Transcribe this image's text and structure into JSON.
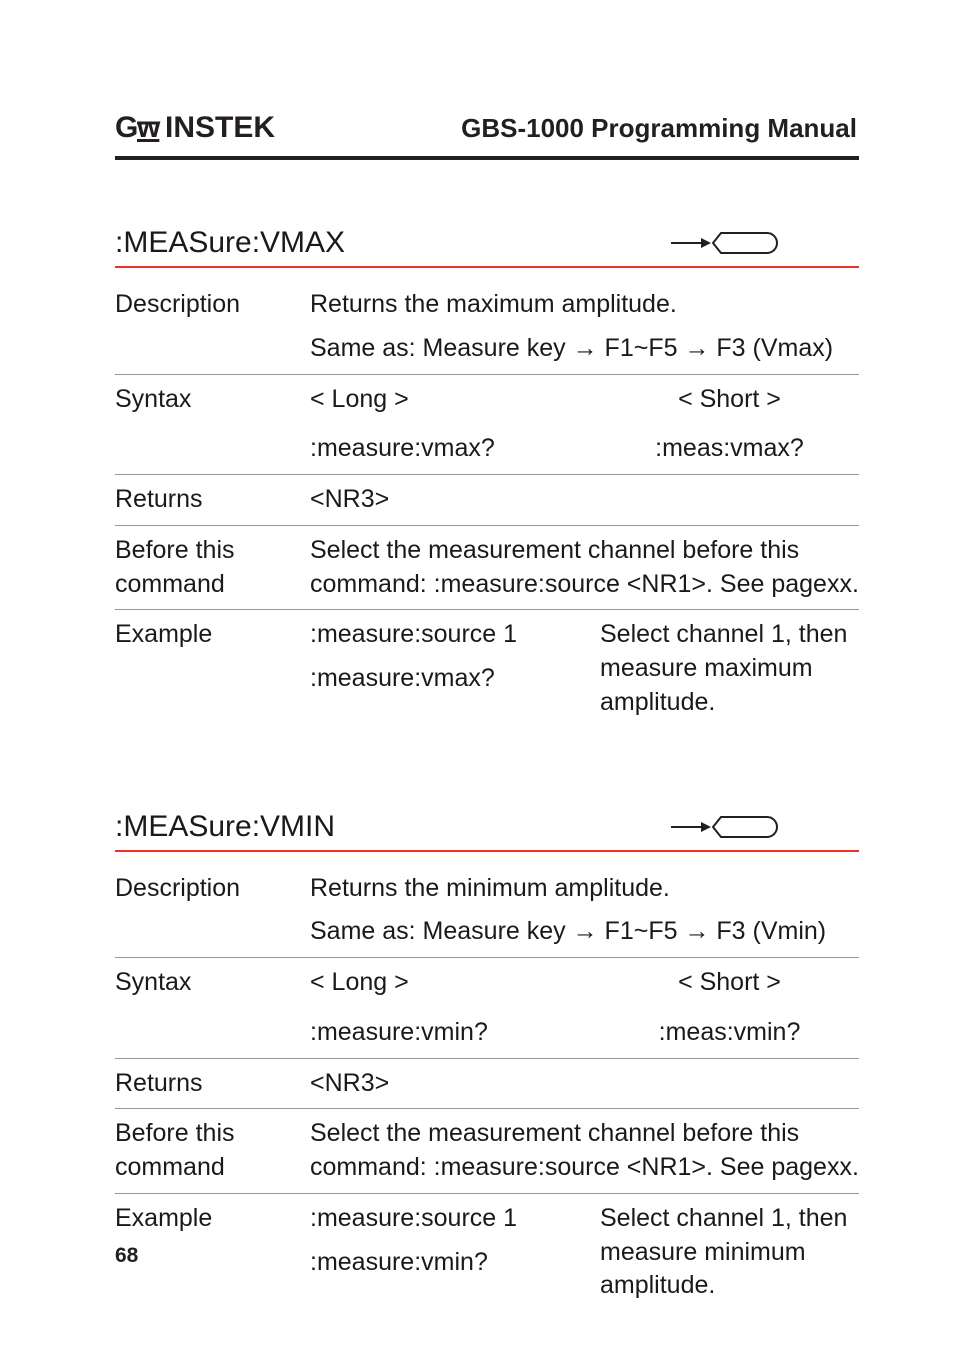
{
  "header": {
    "logo_text": "GW INSTEK",
    "doc_title": "GBS-1000 Programming Manual"
  },
  "sections": [
    {
      "title": ":MEASure:VMAX",
      "description": {
        "line1": "Returns the maximum amplitude.",
        "line2": "Same as: Measure key → F1~F5 → F3 (Vmax)"
      },
      "syntax": {
        "long_label": "< Long >",
        "short_label": "< Short >",
        "long_cmd": ":measure:vmax?",
        "short_cmd": ":meas:vmax?"
      },
      "returns": "<NR3>",
      "before": {
        "label": "Before this command",
        "text": "Select the measurement channel before this command: :measure:source <NR1>. See pagexx."
      },
      "example": {
        "cmd1": ":measure:source 1",
        "cmd2": ":measure:vmax?",
        "result": "Select channel 1, then measure maximum amplitude."
      }
    },
    {
      "title": ":MEASure:VMIN",
      "description": {
        "line1": "Returns the minimum amplitude.",
        "line2": "Same as: Measure key → F1~F5 → F3 (Vmin)"
      },
      "syntax": {
        "long_label": "< Long >",
        "short_label": "< Short >",
        "long_cmd": ":measure:vmin?",
        "short_cmd": ":meas:vmin?"
      },
      "returns": "<NR3>",
      "before": {
        "label": "Before this command",
        "text": "Select the measurement channel before this command: :measure:source <NR1>. See pagexx."
      },
      "example": {
        "cmd1": ":measure:source 1",
        "cmd2": ":measure:vmin?",
        "result": "Select channel 1, then measure minimum amplitude."
      }
    }
  ],
  "labels": {
    "description": "Description",
    "syntax": "Syntax",
    "returns": "Returns",
    "example": "Example"
  },
  "page_number": "68"
}
